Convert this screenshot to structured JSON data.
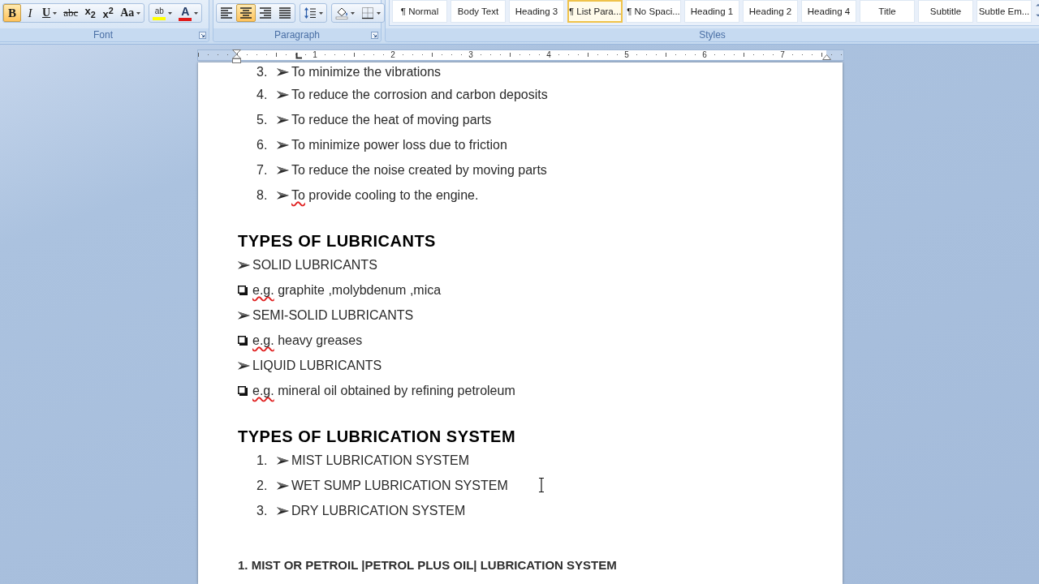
{
  "ribbon": {
    "font_group": {
      "label": "Font",
      "launcher": true,
      "sets": [
        [
          {
            "kind": "bold",
            "text": "B",
            "selected": true,
            "dropdown": false
          },
          {
            "kind": "italic",
            "text": "I",
            "selected": false,
            "dropdown": false
          },
          {
            "kind": "underline",
            "text": "U",
            "selected": false,
            "dropdown": true
          },
          {
            "kind": "strikethrough",
            "text": "abc",
            "selected": false,
            "dropdown": false
          },
          {
            "kind": "subscript",
            "text": "x$_{2}$",
            "selected": false,
            "dropdown": false
          },
          {
            "kind": "superscript",
            "text": "x$^{2}$",
            "selected": false,
            "dropdown": false
          },
          {
            "kind": "change_case",
            "text": "Aa",
            "selected": false,
            "dropdown": true
          }
        ],
        [
          {
            "kind": "highlight",
            "text": "ab",
            "color": "#ffff00",
            "selected": false,
            "dropdown": true
          },
          {
            "kind": "font_color",
            "text": "A",
            "color": "#e01b1b",
            "selected": false,
            "dropdown": true
          }
        ]
      ]
    },
    "paragraph_group": {
      "label": "Paragraph",
      "launcher": true,
      "sets": [
        [
          {
            "kind": "align_left",
            "selected": false,
            "dropdown": false
          },
          {
            "kind": "align_center",
            "selected": true,
            "dropdown": false
          },
          {
            "kind": "align_right",
            "selected": false,
            "dropdown": false
          },
          {
            "kind": "justify",
            "selected": false,
            "dropdown": false
          }
        ],
        [
          {
            "kind": "line_spacing",
            "selected": false,
            "dropdown": true
          }
        ],
        [
          {
            "kind": "shading",
            "selected": false,
            "dropdown": true
          },
          {
            "kind": "borders",
            "selected": false,
            "dropdown": true
          }
        ]
      ]
    },
    "styles_group": {
      "label": "Styles",
      "items": [
        {
          "label": "¶ Normal",
          "selected": false
        },
        {
          "label": "Body Text",
          "selected": false
        },
        {
          "label": "Heading 3",
          "selected": false
        },
        {
          "label": "¶ List Para...",
          "selected": true
        },
        {
          "label": "¶ No Spaci...",
          "selected": false
        },
        {
          "label": "Heading 1",
          "selected": false
        },
        {
          "label": "Heading 2",
          "selected": false
        },
        {
          "label": "Heading 4",
          "selected": false
        },
        {
          "label": "Title",
          "selected": false
        },
        {
          "label": "Subtitle",
          "selected": false
        },
        {
          "label": "Subtle Em...",
          "selected": false
        }
      ]
    }
  },
  "ruler": {
    "numbers": [
      "1",
      "2",
      "3",
      "4",
      "5",
      "6",
      "7"
    ]
  },
  "document": {
    "blocks": [
      {
        "kind": "list",
        "items": [
          {
            "number": "3.",
            "kind": "arrow",
            "parts": [
              {
                "text": "To minimize the vibrations",
                "misspelled": false
              }
            ]
          },
          {
            "number": "4.",
            "kind": "arrow",
            "parts": [
              {
                "text": "To reduce the corrosion and carbon deposits",
                "misspelled": false
              }
            ]
          },
          {
            "number": "5.",
            "kind": "arrow",
            "parts": [
              {
                "text": "To reduce the heat of moving parts",
                "misspelled": false
              }
            ]
          },
          {
            "number": "6.",
            "kind": "arrow",
            "parts": [
              {
                "text": "To minimize power loss due to friction",
                "misspelled": false
              }
            ]
          },
          {
            "number": "7.",
            "kind": "arrow",
            "parts": [
              {
                "text": "To reduce the noise created by moving parts",
                "misspelled": false
              }
            ]
          },
          {
            "number": "8.",
            "kind": "arrow",
            "parts": [
              {
                "text": "To",
                "misspelled": true
              },
              {
                "text": " provide cooling to the engine.",
                "misspelled": false
              }
            ]
          }
        ]
      },
      {
        "kind": "heading",
        "text": "TYPES OF LUBRICANTS"
      },
      {
        "kind": "list",
        "items": [
          {
            "kind": "arrow",
            "parts": [
              {
                "text": "SOLID LUBRICANTS",
                "misspelled": false
              }
            ]
          },
          {
            "kind": "square",
            "parts": [
              {
                "text": "e.g.",
                "misspelled": true
              },
              {
                "text": " graphite ,molybdenum ,mica",
                "misspelled": false
              }
            ]
          },
          {
            "kind": "arrow",
            "parts": [
              {
                "text": "SEMI-SOLID LUBRICANTS",
                "misspelled": false
              }
            ]
          },
          {
            "kind": "square",
            "parts": [
              {
                "text": "e.g.",
                "misspelled": true
              },
              {
                "text": " heavy greases",
                "misspelled": false
              }
            ]
          },
          {
            "kind": "arrow",
            "parts": [
              {
                "text": "LIQUID LUBRICANTS",
                "misspelled": false
              }
            ]
          },
          {
            "kind": "square",
            "parts": [
              {
                "text": "e.g.",
                "misspelled": true
              },
              {
                "text": " mineral oil obtained by refining petroleum",
                "misspelled": false
              }
            ]
          }
        ]
      },
      {
        "kind": "heading",
        "text": "TYPES OF LUBRICATION SYSTEM"
      },
      {
        "kind": "list",
        "items": [
          {
            "number": "1.",
            "kind": "arrow",
            "parts": [
              {
                "text": "MIST LUBRICATION SYSTEM",
                "misspelled": false
              }
            ]
          },
          {
            "number": "2.",
            "kind": "arrow",
            "parts": [
              {
                "text": "WET SUMP LUBRICATION SYSTEM",
                "misspelled": false
              }
            ]
          },
          {
            "number": "3.",
            "kind": "arrow",
            "parts": [
              {
                "text": "DRY LUBRICATION SYSTEM",
                "misspelled": false
              }
            ]
          }
        ]
      },
      {
        "kind": "subheading",
        "text": "1. MIST OR PETROIL |PETROL PLUS OIL| LUBRICATION SYSTEM"
      }
    ]
  }
}
